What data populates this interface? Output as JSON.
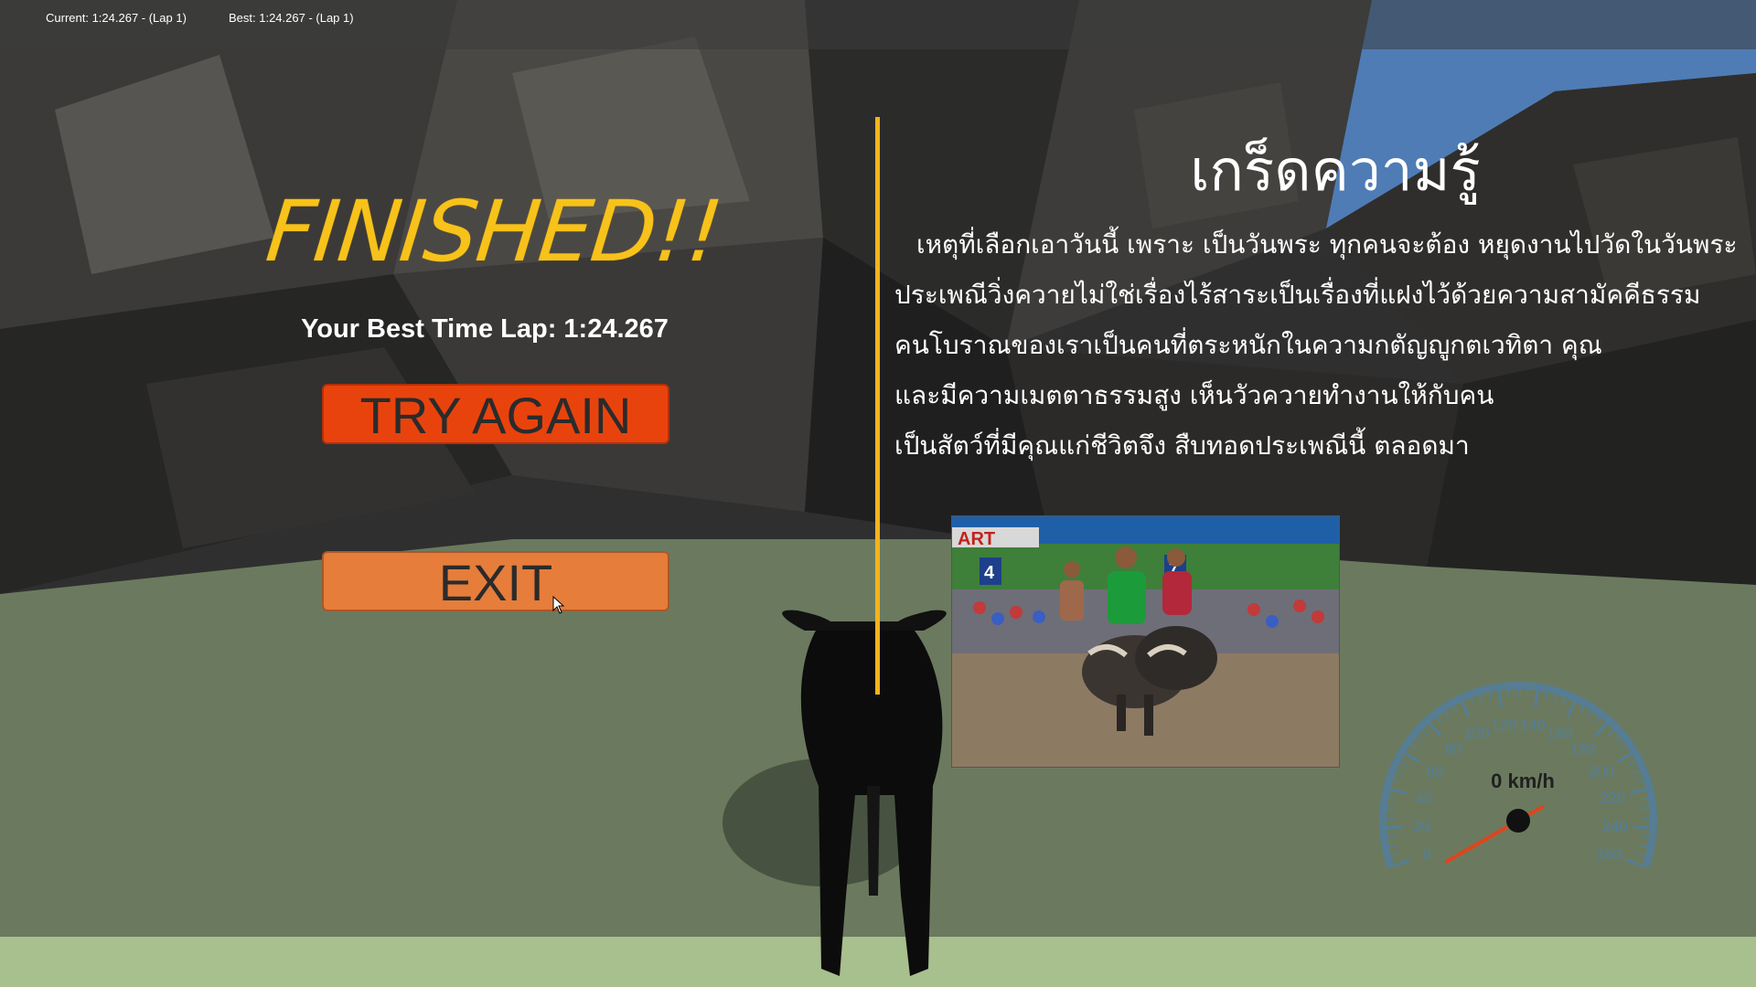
{
  "hud": {
    "current_lap": "Current: 1:24.267 - (Lap 1)",
    "best_lap": "Best: 1:24.267 - (Lap 1)"
  },
  "finish_panel": {
    "title": "FINISHED!!",
    "best_time": "Your Best Time Lap: 1:24.267",
    "try_again_label": "TRY AGAIN",
    "exit_label": "EXIT"
  },
  "knowledge": {
    "title": "เกร็ดความรู้",
    "lines": [
      "เหตุที่เลือกเอาวันนี้  เพราะ เป็นวันพระ ทุกคนจะต้อง หยุดงานไปวัดในวันพระ",
      "ประเพณีวิ่งควายไม่ใช่เรื่องไร้สาระเป็นเรื่องที่แฝงไว้ด้วยความสามัคคีธรรม",
      "คนโบราณของเราเป็นคนที่ตระหนักในความกตัญญูกตเวทิตา คุณ",
      "และมีความเมตตาธรรมสูง เห็นวัวควายทำงานให้กับคน",
      "เป็นสัตว์ที่มีคุณแก่ชีวิตจึง สืบทอดประเพณีนี้ ตลอดมา"
    ],
    "photo_banner": "ART",
    "photo_numbers": [
      "4",
      "7"
    ]
  },
  "speedometer": {
    "readout": "0 km/h",
    "speed": 0,
    "ticks": [
      "0",
      "20",
      "40",
      "60",
      "80",
      "100",
      "120",
      "140",
      "160",
      "180",
      "200",
      "220",
      "240",
      "260"
    ]
  },
  "colors": {
    "title": "#f7c21a",
    "try_again": "#e9430d",
    "exit": "#e67d3a",
    "divider": "#f2b41c",
    "gauge": "#4f7fa6",
    "needle": "#e0441c"
  }
}
